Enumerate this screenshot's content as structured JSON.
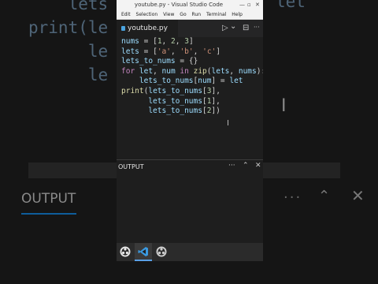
{
  "window": {
    "title": "youtube.py - Visual Studio Code",
    "controls": {
      "minimize": "—",
      "maximize": "▫",
      "close": "✕"
    }
  },
  "menu": [
    "Edit",
    "Selection",
    "View",
    "Go",
    "Run",
    "Terminal",
    "Help"
  ],
  "tab": {
    "label": "youtube.py"
  },
  "editor_actions": {
    "run": "▷",
    "run_dropdown": "⌄",
    "split": "⊟",
    "more": "···"
  },
  "code_lines": [
    "nums = [1, 2, 3]",
    "lets = ['a', 'b', 'c']",
    "lets_to_nums = {}",
    "for let, num in zip(lets, nums):",
    "    lets_to_nums[num] = let",
    "print(lets_to_nums[3],",
    "      lets_to_nums[1],",
    "      lets_to_nums[2])"
  ],
  "panel": {
    "title": "OUTPUT",
    "actions": {
      "more": "···",
      "collapse": "⌃",
      "close": "✕"
    }
  },
  "background": {
    "code_lines": [
      "    lets",
      "print(le",
      "      le",
      "      le"
    ],
    "let_fragment": "let",
    "output_label": "OUTPUT"
  },
  "colors": {
    "accent": "#0e639c",
    "editor_bg": "#1e1e1e",
    "keyword": "#c586c0",
    "variable": "#9cdcfe",
    "function": "#dcdcaa",
    "number": "#b5cea8",
    "string": "#ce9178"
  },
  "taskbar": [
    "obs-icon",
    "vscode-icon",
    "obs-icon"
  ]
}
